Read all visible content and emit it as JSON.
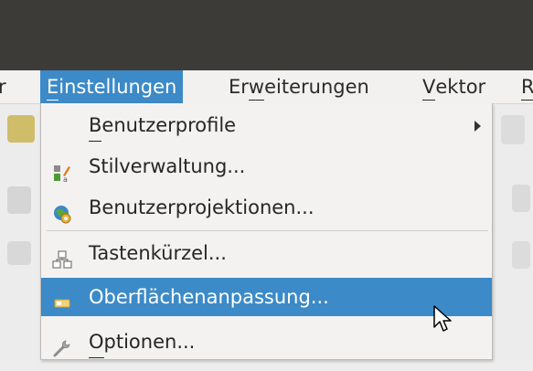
{
  "menubar": {
    "partial_left": "r",
    "items": [
      {
        "label_pre": "",
        "accel": "E",
        "label_post": "instellungen",
        "active": true
      },
      {
        "label_pre": "Er",
        "accel": "w",
        "label_post": "eiterungen",
        "active": false
      },
      {
        "label_pre": "",
        "accel": "V",
        "label_post": "ektor",
        "active": false
      },
      {
        "label_pre": "",
        "accel": "R",
        "label_post": "",
        "active": false
      }
    ]
  },
  "dropdown": {
    "items": [
      {
        "label_pre": "",
        "accel": "B",
        "label_post": "enutzerprofile",
        "icon": "none",
        "submenu": true
      },
      {
        "label_pre": "Stilverwaltung...",
        "accel": "",
        "label_post": "",
        "icon": "style-manager-icon"
      },
      {
        "label_pre": "Benutzerprojektionen...",
        "accel": "",
        "label_post": "",
        "icon": "globe-gear-icon"
      },
      {
        "label_pre": "Tastenkürzel...",
        "accel": "",
        "label_post": "",
        "icon": "keyboard-shortcuts-icon"
      },
      {
        "label_pre": "Oberflächenanpassung...",
        "accel": "",
        "label_post": "",
        "icon": "interface-customization-icon",
        "highlighted": true
      },
      {
        "label_pre": "",
        "accel": "O",
        "label_post": "ptionen...",
        "icon": "wrench-icon"
      }
    ]
  },
  "colors": {
    "titlebar": "#3c3b37",
    "highlight": "#3c8ac7",
    "menu_bg": "#f3f2f1"
  }
}
